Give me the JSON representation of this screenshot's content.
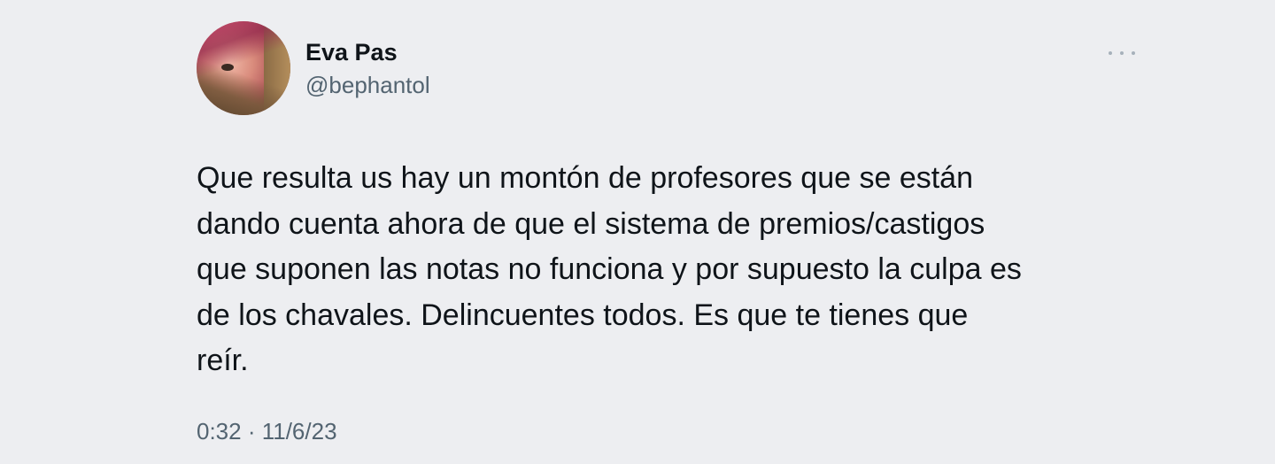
{
  "author": {
    "name": "Eva Pas",
    "handle": "@bephantol",
    "avatar_icon": "profile-photo"
  },
  "more_icon": "ellipsis-icon",
  "tweet": {
    "text": "Que resulta us hay un montón de profesores que se están\ndando cuenta ahora de que el sistema de premios/castigos\nque suponen las notas no funciona y por supuesto la culpa es\nde los chavales. Delincuentes todos. Es que te tienes que\nreír.",
    "timestamp": "0:32 · 11/6/23"
  },
  "colors": {
    "background": "#edeef1",
    "primary_text": "#0f1419",
    "secondary_text": "#536471"
  }
}
